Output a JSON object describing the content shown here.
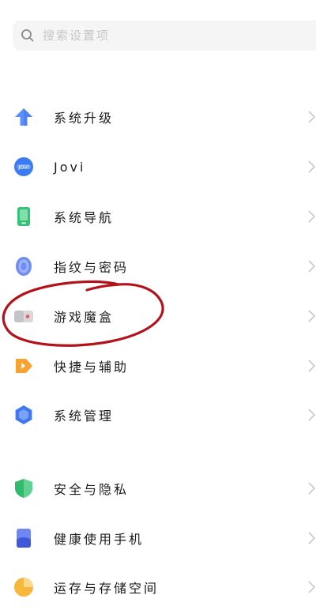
{
  "search": {
    "placeholder": "搜索设置项"
  },
  "settings": {
    "items": [
      {
        "label": "系统升级",
        "icon": "arrow-up-icon"
      },
      {
        "label": "Jovi",
        "icon": "jovi-icon"
      },
      {
        "label": "系统导航",
        "icon": "phone-navigation-icon"
      },
      {
        "label": "指纹与密码",
        "icon": "fingerprint-icon"
      },
      {
        "label": "游戏魔盒",
        "icon": "game-box-icon"
      },
      {
        "label": "快捷与辅助",
        "icon": "shortcut-icon"
      },
      {
        "label": "系统管理",
        "icon": "system-management-icon"
      },
      {
        "label": "安全与隐私",
        "icon": "shield-icon"
      },
      {
        "label": "健康使用手机",
        "icon": "healthy-usage-icon"
      },
      {
        "label": "运存与存储空间",
        "icon": "storage-pie-icon"
      }
    ]
  },
  "colors": {
    "accent_blue": "#5b8ff9",
    "annotation_red": "#b3121b"
  }
}
